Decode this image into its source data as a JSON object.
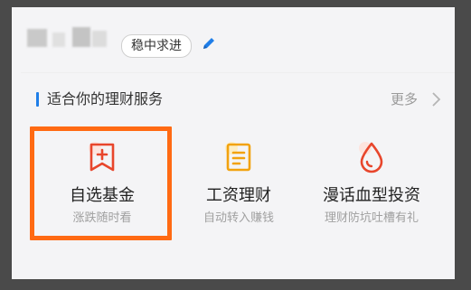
{
  "profile": {
    "tag_label": "稳中求进"
  },
  "section": {
    "title": "适合你的理财服务",
    "more_label": "更多"
  },
  "services": [
    {
      "title": "自选基金",
      "subtitle": "涨跌随时看",
      "icon": "bookmark-plus-icon"
    },
    {
      "title": "工资理财",
      "subtitle": "自动转入赚钱",
      "icon": "document-icon"
    },
    {
      "title": "漫话血型投资",
      "subtitle": "理财防坑吐槽有礼",
      "icon": "blood-drop-icon"
    }
  ],
  "colors": {
    "accent_blue": "#1f7ee8",
    "icon_red": "#e8462c",
    "icon_orange": "#f2a20e",
    "highlight_orange": "#ff6a13"
  }
}
